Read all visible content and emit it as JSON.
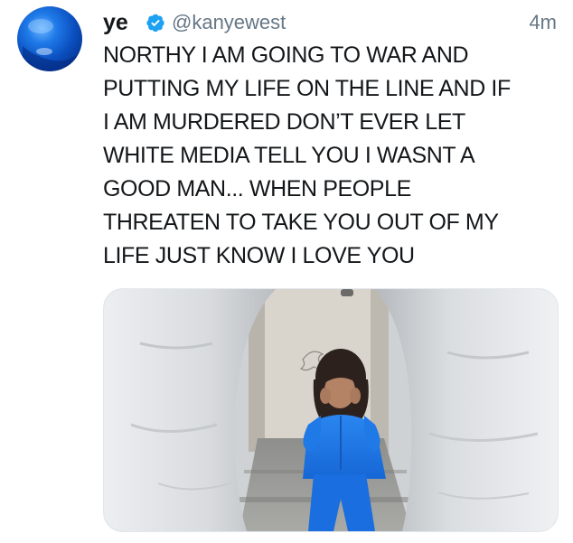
{
  "tweet": {
    "avatar_icon": "blue-globe-avatar-icon",
    "author": {
      "name": "ye",
      "verified_icon": "verified-badge-icon",
      "handle": "@kanyewest"
    },
    "time": "4m",
    "text_lines": [
      "NORTHY I AM GOING TO WAR AND",
      "PUTTING MY LIFE ON THE LINE AND IF",
      "I AM MURDERED DON’T EVER LET",
      "WHITE MEDIA TELL YOU I WASNT A",
      "GOOD MAN... WHEN PEOPLE",
      "THREATEN TO TAKE YOU OUT OF MY",
      "LIFE JUST KNOW I LOVE YOU"
    ],
    "media": {
      "kind": "photo"
    }
  },
  "colors": {
    "text": "#14171a",
    "secondary": "#657786",
    "verified": "#1da1f2",
    "avatar": "#0b4fc0",
    "outfit": "#1f7ae8"
  }
}
